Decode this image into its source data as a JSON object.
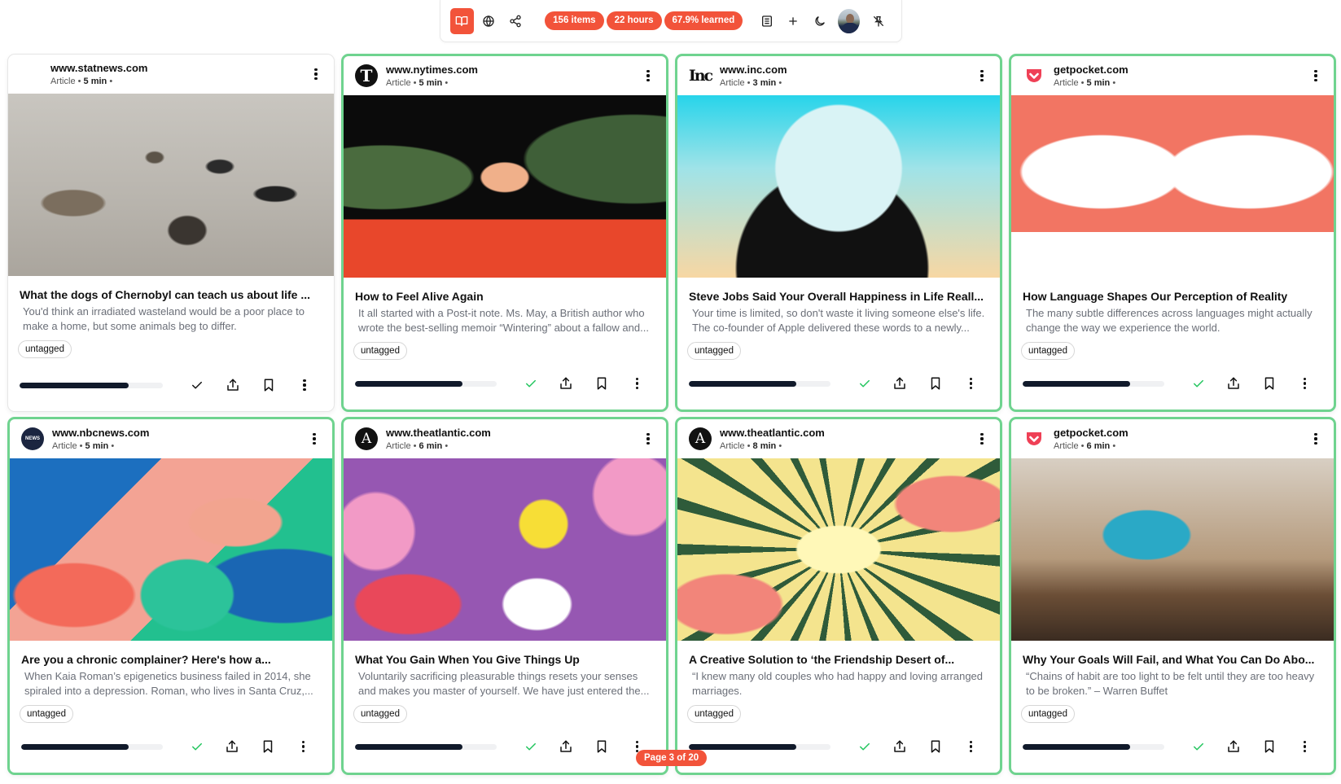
{
  "toolbar": {
    "buttons": [
      {
        "name": "reader-mode",
        "icon": "book-open-icon",
        "active": true
      },
      {
        "name": "web",
        "icon": "globe-icon",
        "active": false
      },
      {
        "name": "share",
        "icon": "share-icon",
        "active": false
      }
    ],
    "stats": {
      "items": "156 items",
      "hours": "22 hours",
      "learned": "67.9% learned"
    },
    "right_buttons": [
      {
        "name": "list-view",
        "icon": "list-icon"
      },
      {
        "name": "add",
        "icon": "plus-icon"
      },
      {
        "name": "dark-mode",
        "icon": "moon-icon"
      },
      {
        "name": "profile",
        "icon": "avatar"
      },
      {
        "name": "unpin",
        "icon": "pin-off-icon"
      }
    ],
    "accent_color": "#f2533a"
  },
  "cards": [
    {
      "domain": "www.statnews.com",
      "type": "Article",
      "read_time": "5 min",
      "logo": "statnews",
      "title": "What the dogs of Chernobyl can teach us about life ...",
      "description": "You'd think an irradiated wasteland would be a poor place to make a home, but some animals beg to differ.",
      "tag": "untagged",
      "progress": 0.76,
      "read": false,
      "highlighted": false
    },
    {
      "domain": "www.nytimes.com",
      "type": "Article",
      "read_time": "5 min",
      "logo": "nytimes",
      "title": "How to Feel Alive Again",
      "description": "It all started with a Post-it note. Ms. May, a British author who wrote the best-selling memoir “Wintering” about a fallow and...",
      "tag": "untagged",
      "progress": 0.76,
      "read": true,
      "highlighted": true
    },
    {
      "domain": "www.inc.com",
      "type": "Article",
      "read_time": "3 min",
      "logo": "inc",
      "title": "Steve Jobs Said Your Overall Happiness in Life Reall...",
      "description": "Your time is limited, so don't waste it living someone else's life. The co-founder of Apple delivered these words to a newly...",
      "tag": "untagged",
      "progress": 0.76,
      "read": true,
      "highlighted": true
    },
    {
      "domain": "getpocket.com",
      "type": "Article",
      "read_time": "5 min",
      "logo": "pocket",
      "title": "How Language Shapes Our Perception of Reality",
      "description": "The many subtle differences across languages might actually change the way we experience the world.",
      "tag": "untagged",
      "progress": 0.76,
      "read": true,
      "highlighted": true
    },
    {
      "domain": "www.nbcnews.com",
      "type": "Article",
      "read_time": "5 min",
      "logo": "nbcnews",
      "title": "Are you a chronic complainer? Here's how a...",
      "description": "When Kaia Roman’s epigenetics business failed in 2014, she spiraled into a depression. Roman, who lives in Santa Cruz,...",
      "tag": "untagged",
      "progress": 0.76,
      "read": true,
      "highlighted": true
    },
    {
      "domain": "www.theatlantic.com",
      "type": "Article",
      "read_time": "6 min",
      "logo": "atlantic",
      "title": "What You Gain When You Give Things Up",
      "description": "Voluntarily sacrificing pleasurable things resets your senses and makes you master of yourself. We have just entered the...",
      "tag": "untagged",
      "progress": 0.76,
      "read": true,
      "highlighted": true
    },
    {
      "domain": "www.theatlantic.com",
      "type": "Article",
      "read_time": "8 min",
      "logo": "atlantic",
      "title": "A Creative Solution to ‘the Friendship Desert of...",
      "description": "“I knew many old couples who had happy and loving arranged marriages.",
      "tag": "untagged",
      "progress": 0.76,
      "read": true,
      "highlighted": true
    },
    {
      "domain": "getpocket.com",
      "type": "Article",
      "read_time": "6 min",
      "logo": "pocket",
      "title": "Why Your Goals Will Fail, and What You Can Do Abo...",
      "description": "“Chains of habit are too light to be felt until they are too heavy to be broken.” – Warren Buffet",
      "tag": "untagged",
      "progress": 0.76,
      "read": true,
      "highlighted": true
    }
  ],
  "logo_text": {
    "nytimes": "T",
    "inc": "Inc",
    "nbcnews": "NEWS",
    "atlantic": "A"
  },
  "pagination": {
    "label": "Page 3 of 20"
  },
  "colors": {
    "accent": "#f2533a",
    "highlight_border": "#6fd38f",
    "read_check": "#22c55e",
    "progress_fill": "#111a2b"
  }
}
